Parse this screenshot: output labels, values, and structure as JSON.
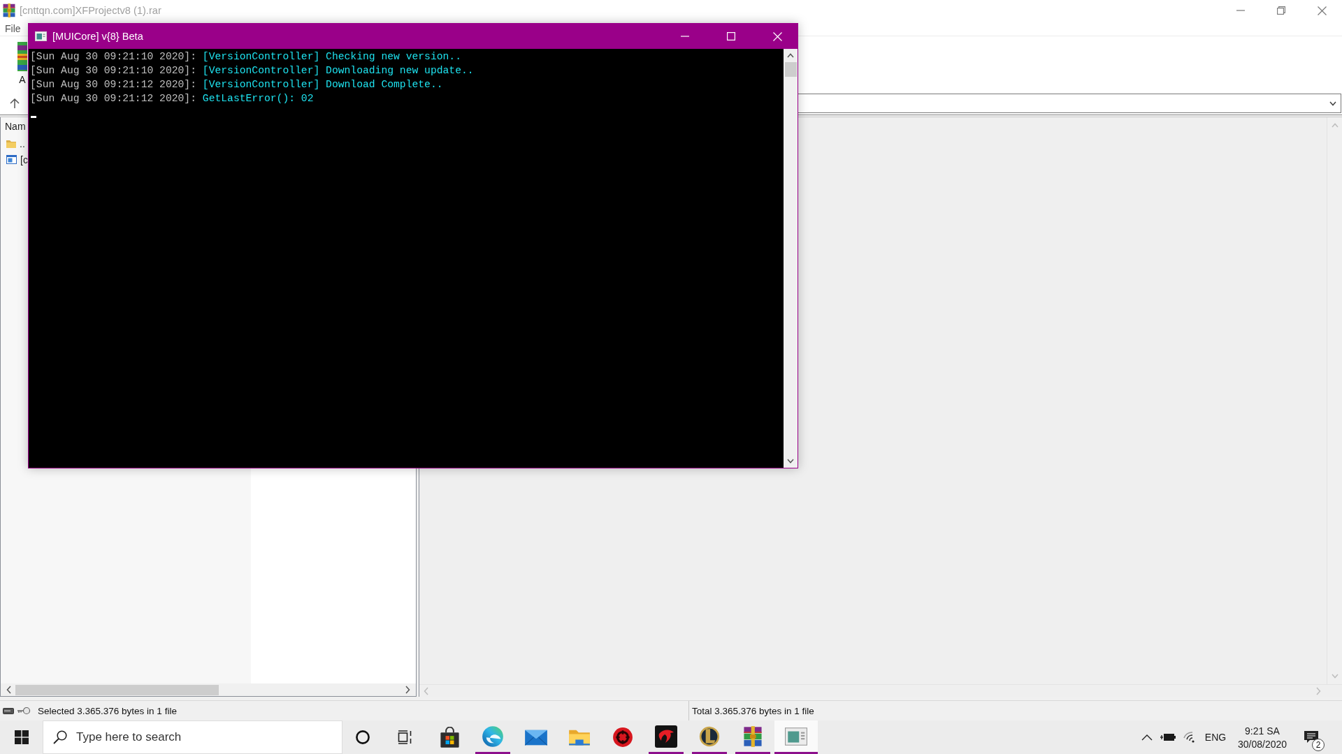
{
  "archive_window": {
    "title": "[cnttqn.com]XFProjectv8 (1).rar",
    "menu": [
      "File"
    ],
    "toolbar": [
      {
        "label": "A"
      }
    ],
    "file_list": {
      "columns": [
        "Nam"
      ],
      "rows": [
        {
          "kind": "parent",
          "name": ".."
        },
        {
          "kind": "file",
          "name": "[c"
        }
      ]
    },
    "status_bar": {
      "selection": "Selected 3.365.376 bytes in 1 file",
      "total": "Total 3.365.376 bytes in 1 file"
    }
  },
  "console_window": {
    "title": "[MUICore] v{8} Beta",
    "lines": [
      {
        "stamp": "[Sun Aug 30 09:21:10 2020]:",
        "message": "[VersionController] Checking new version.."
      },
      {
        "stamp": "[Sun Aug 30 09:21:10 2020]:",
        "message": "[VersionController] Downloading new update.."
      },
      {
        "stamp": "[Sun Aug 30 09:21:12 2020]:",
        "message": "[VersionController] Download Complete.."
      },
      {
        "stamp": "[Sun Aug 30 09:21:12 2020]:",
        "message": "GetLastError(): 02"
      }
    ]
  },
  "taskbar": {
    "search": {
      "placeholder": "Type here to search"
    },
    "apps": [
      {
        "kind": "store",
        "running": false,
        "selected": false
      },
      {
        "kind": "browser",
        "running": true,
        "selected": false
      },
      {
        "kind": "mail",
        "running": false,
        "selected": false
      },
      {
        "kind": "folders",
        "running": false,
        "selected": false
      },
      {
        "kind": "shield",
        "running": false,
        "selected": false
      },
      {
        "kind": "dragon",
        "running": true,
        "selected": false
      },
      {
        "kind": "crest",
        "running": true,
        "selected": false
      },
      {
        "kind": "archiver",
        "running": true,
        "selected": false
      },
      {
        "kind": "console",
        "running": true,
        "selected": true
      }
    ],
    "tray": {
      "language": "ENG",
      "time": "9:21 SA",
      "date": "30/08/2020",
      "notifications": "2"
    }
  }
}
